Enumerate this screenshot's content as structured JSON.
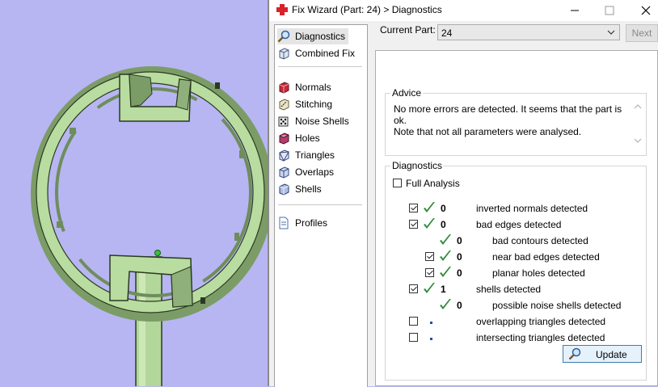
{
  "window": {
    "title": "Fix Wizard (Part: 24) > Diagnostics",
    "icon": "red-cross-icon"
  },
  "nav": {
    "items": [
      {
        "label": "Diagnostics",
        "icon": "magnifier-icon",
        "selected": true
      },
      {
        "label": "Combined Fix",
        "icon": "cube-icon"
      },
      {
        "label": "Normals",
        "icon": "red-cube-icon"
      },
      {
        "label": "Stitching",
        "icon": "stitch-icon"
      },
      {
        "label": "Noise Shells",
        "icon": "dice-icon"
      },
      {
        "label": "Holes",
        "icon": "hole-cube-icon"
      },
      {
        "label": "Triangles",
        "icon": "triangle-cube-icon"
      },
      {
        "label": "Overlaps",
        "icon": "overlap-cube-icon"
      },
      {
        "label": "Shells",
        "icon": "shells-cube-icon"
      },
      {
        "label": "Profiles",
        "icon": "document-icon"
      }
    ]
  },
  "part": {
    "label": "Current Part:",
    "value": "24",
    "next_label": "Next"
  },
  "advice": {
    "title": "Advice",
    "line1": "No more errors are detected. It seems that the part is ok.",
    "line2": "Note that not all parameters were analysed."
  },
  "diagnostics": {
    "title": "Diagnostics",
    "full_analysis_label": "Full Analysis",
    "full_analysis_checked": false,
    "rows": [
      {
        "checkbox": true,
        "checked": true,
        "status": "ok",
        "count": "0",
        "label": "inverted normals detected",
        "indent": 0
      },
      {
        "checkbox": true,
        "checked": true,
        "status": "ok",
        "count": "0",
        "label": "bad edges detected",
        "indent": 0
      },
      {
        "checkbox": false,
        "checked": false,
        "status": "ok",
        "count": "0",
        "label": "bad contours detected",
        "indent": 1
      },
      {
        "checkbox": true,
        "checked": true,
        "status": "ok",
        "count": "0",
        "label": "near bad edges detected",
        "indent": 1
      },
      {
        "checkbox": true,
        "checked": true,
        "status": "ok",
        "count": "0",
        "label": "planar holes detected",
        "indent": 1
      },
      {
        "checkbox": true,
        "checked": true,
        "status": "ok",
        "count": "1",
        "label": "shells detected",
        "indent": 0
      },
      {
        "checkbox": false,
        "checked": false,
        "status": "ok",
        "count": "0",
        "label": "possible noise shells detected",
        "indent": 1
      },
      {
        "checkbox": true,
        "checked": false,
        "status": "pending",
        "count": "",
        "label": "overlapping triangles detected",
        "indent": 0
      },
      {
        "checkbox": true,
        "checked": false,
        "status": "pending",
        "count": "",
        "label": "intersecting triangles detected",
        "indent": 0
      }
    ],
    "update_label": "Update"
  },
  "colors": {
    "viewport_bg": "#b7b6f2",
    "model_fill": "#b9dca0",
    "model_edge": "#2a3a20",
    "check_green": "#2e8b3a"
  }
}
